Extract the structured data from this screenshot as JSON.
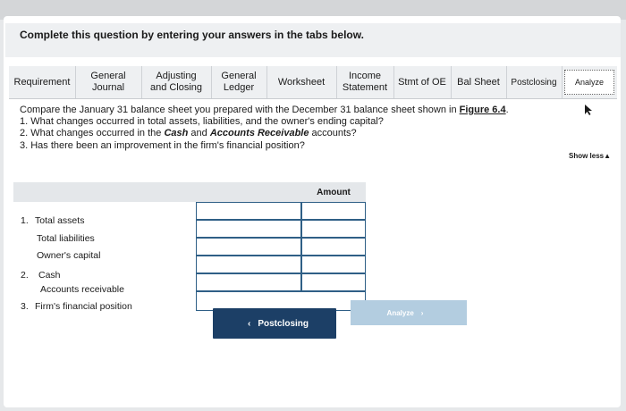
{
  "instruction": "Complete this question by entering your answers in the tabs below.",
  "tabs": [
    {
      "label": "Requirement"
    },
    {
      "label": "General\nJournal"
    },
    {
      "label": "Adjusting\nand Closing"
    },
    {
      "label": "General\nLedger"
    },
    {
      "label": "Worksheet"
    },
    {
      "label": "Income\nStatement"
    },
    {
      "label": "Stmt of OE"
    },
    {
      "label": "Bal Sheet"
    },
    {
      "label": "Postclosing"
    },
    {
      "label": "Analyze"
    }
  ],
  "question": {
    "intro_before": "Compare the January 31 balance sheet you prepared with the December 31 balance sheet shown in ",
    "link_text": "Figure 6.4",
    "intro_after": ".",
    "q1": "1. What changes occurred in total assets, liabilities, and the owner's ending capital?",
    "q2_pre": "2. What changes occurred in the ",
    "q2_cash": "Cash",
    "q2_mid": " and ",
    "q2_ar": "Accounts Receivable",
    "q2_post": " accounts?",
    "q3": "3. Has there been an improvement in the firm's financial position?"
  },
  "show_less": "Show less",
  "table": {
    "amount_header": "Amount",
    "rows": [
      {
        "num": "1.",
        "label": "Total assets"
      },
      {
        "num": "",
        "label": "Total liabilities"
      },
      {
        "num": "",
        "label": "Owner's capital"
      },
      {
        "num": "2.",
        "label": "Cash"
      },
      {
        "num": "",
        "label": "Accounts receivable"
      },
      {
        "num": "3.",
        "label": "Firm's financial position"
      }
    ]
  },
  "nav": {
    "prev_label": "Postclosing",
    "next_label": "Analyze"
  }
}
